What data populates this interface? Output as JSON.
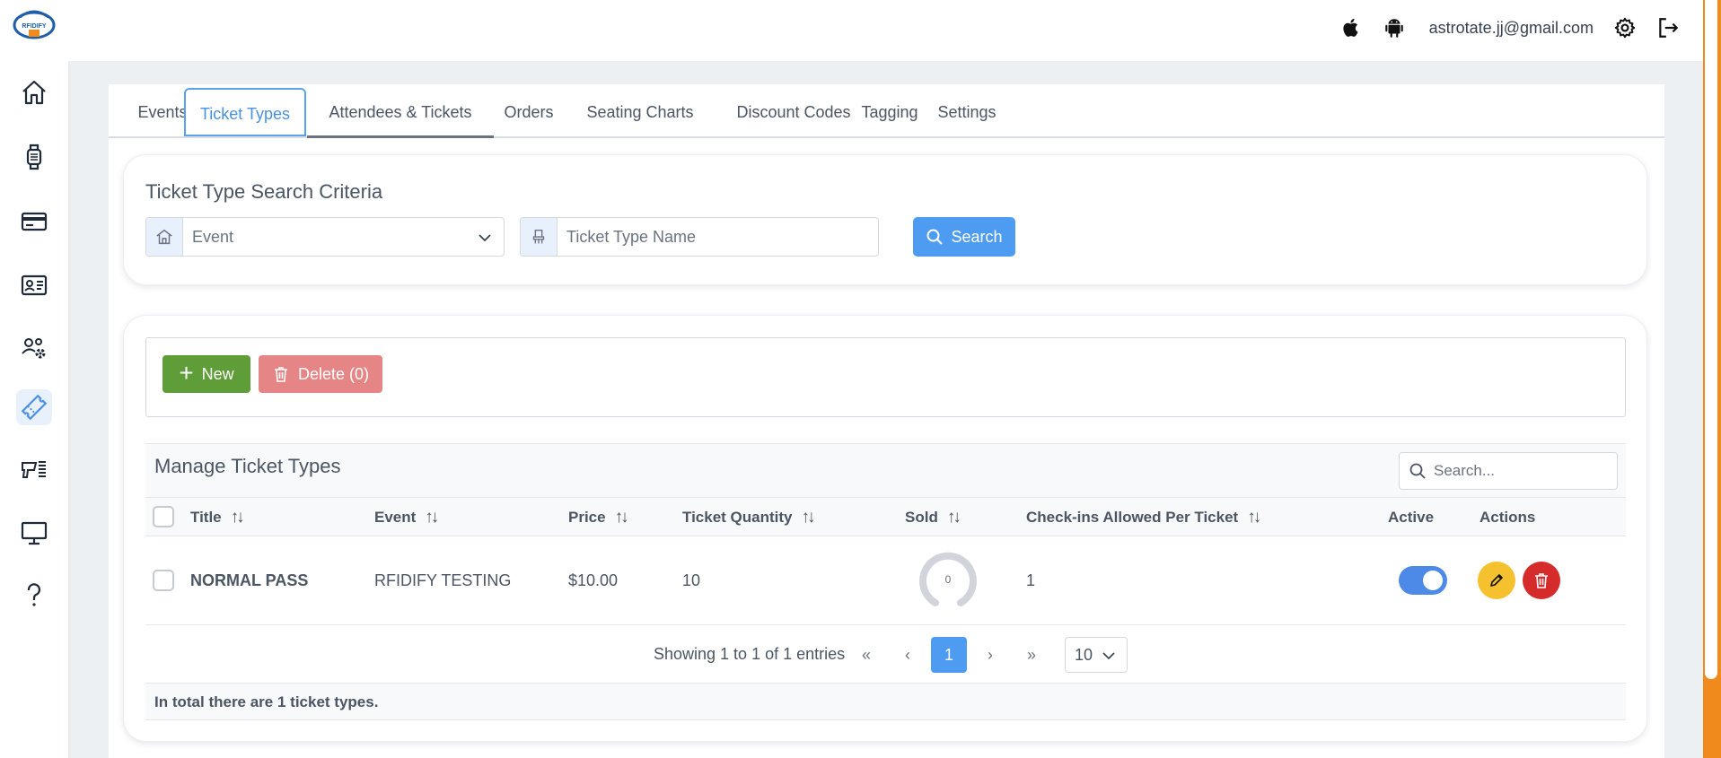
{
  "topbar": {
    "user_email": "astrotate.jj@gmail.com",
    "icons": [
      "apple-icon",
      "android-icon",
      "gear-icon",
      "logout-icon"
    ]
  },
  "logo": {
    "text": "RFIDIFY"
  },
  "sidebar": {
    "items": [
      {
        "icon": "home-icon"
      },
      {
        "icon": "wristband-icon"
      },
      {
        "icon": "credit-card-icon"
      },
      {
        "icon": "id-card-icon"
      },
      {
        "icon": "users-settings-icon"
      },
      {
        "icon": "ticket-icon",
        "active": true
      },
      {
        "icon": "scanner-icon"
      },
      {
        "icon": "monitor-icon"
      },
      {
        "icon": "help-icon"
      }
    ]
  },
  "tabs": [
    {
      "label": "Events"
    },
    {
      "label": "Ticket Types",
      "active": true
    },
    {
      "label": "Attendees & Tickets"
    },
    {
      "label": "Orders"
    },
    {
      "label": "Seating Charts"
    },
    {
      "label": "Discount Codes"
    },
    {
      "label": "Tagging"
    },
    {
      "label": "Settings"
    }
  ],
  "search_criteria": {
    "title": "Ticket Type Search Criteria",
    "event_select": "Event",
    "ticket_type_placeholder": "Ticket Type Name",
    "search_button": "Search"
  },
  "toolbar": {
    "new_label": "New",
    "delete_label": "Delete (0)"
  },
  "table": {
    "title": "Manage Ticket Types",
    "search_placeholder": "Search...",
    "columns": [
      "Title",
      "Event",
      "Price",
      "Ticket Quantity",
      "Sold",
      "Check-ins Allowed Per Ticket",
      "Active",
      "Actions"
    ],
    "rows": [
      {
        "title": "NORMAL PASS",
        "event": "RFIDIFY TESTING",
        "price": "$10.00",
        "quantity": "10",
        "sold": "0",
        "checkins": "1",
        "active": true
      }
    ]
  },
  "pagination": {
    "info": "Showing 1 to 1 of 1 entries",
    "first": "«",
    "prev": "‹",
    "current": "1",
    "next": "›",
    "last": "»",
    "page_size": "10"
  },
  "footer": {
    "summary": "In total there are 1 ticket types."
  },
  "colors": {
    "accent": "#4d9cf2",
    "new_button": "#5f9d39",
    "delete_button": "#e58585",
    "edit_action": "#f5c12e",
    "delete_action": "#d62b2b",
    "scrollbar": "#f08a1c"
  }
}
